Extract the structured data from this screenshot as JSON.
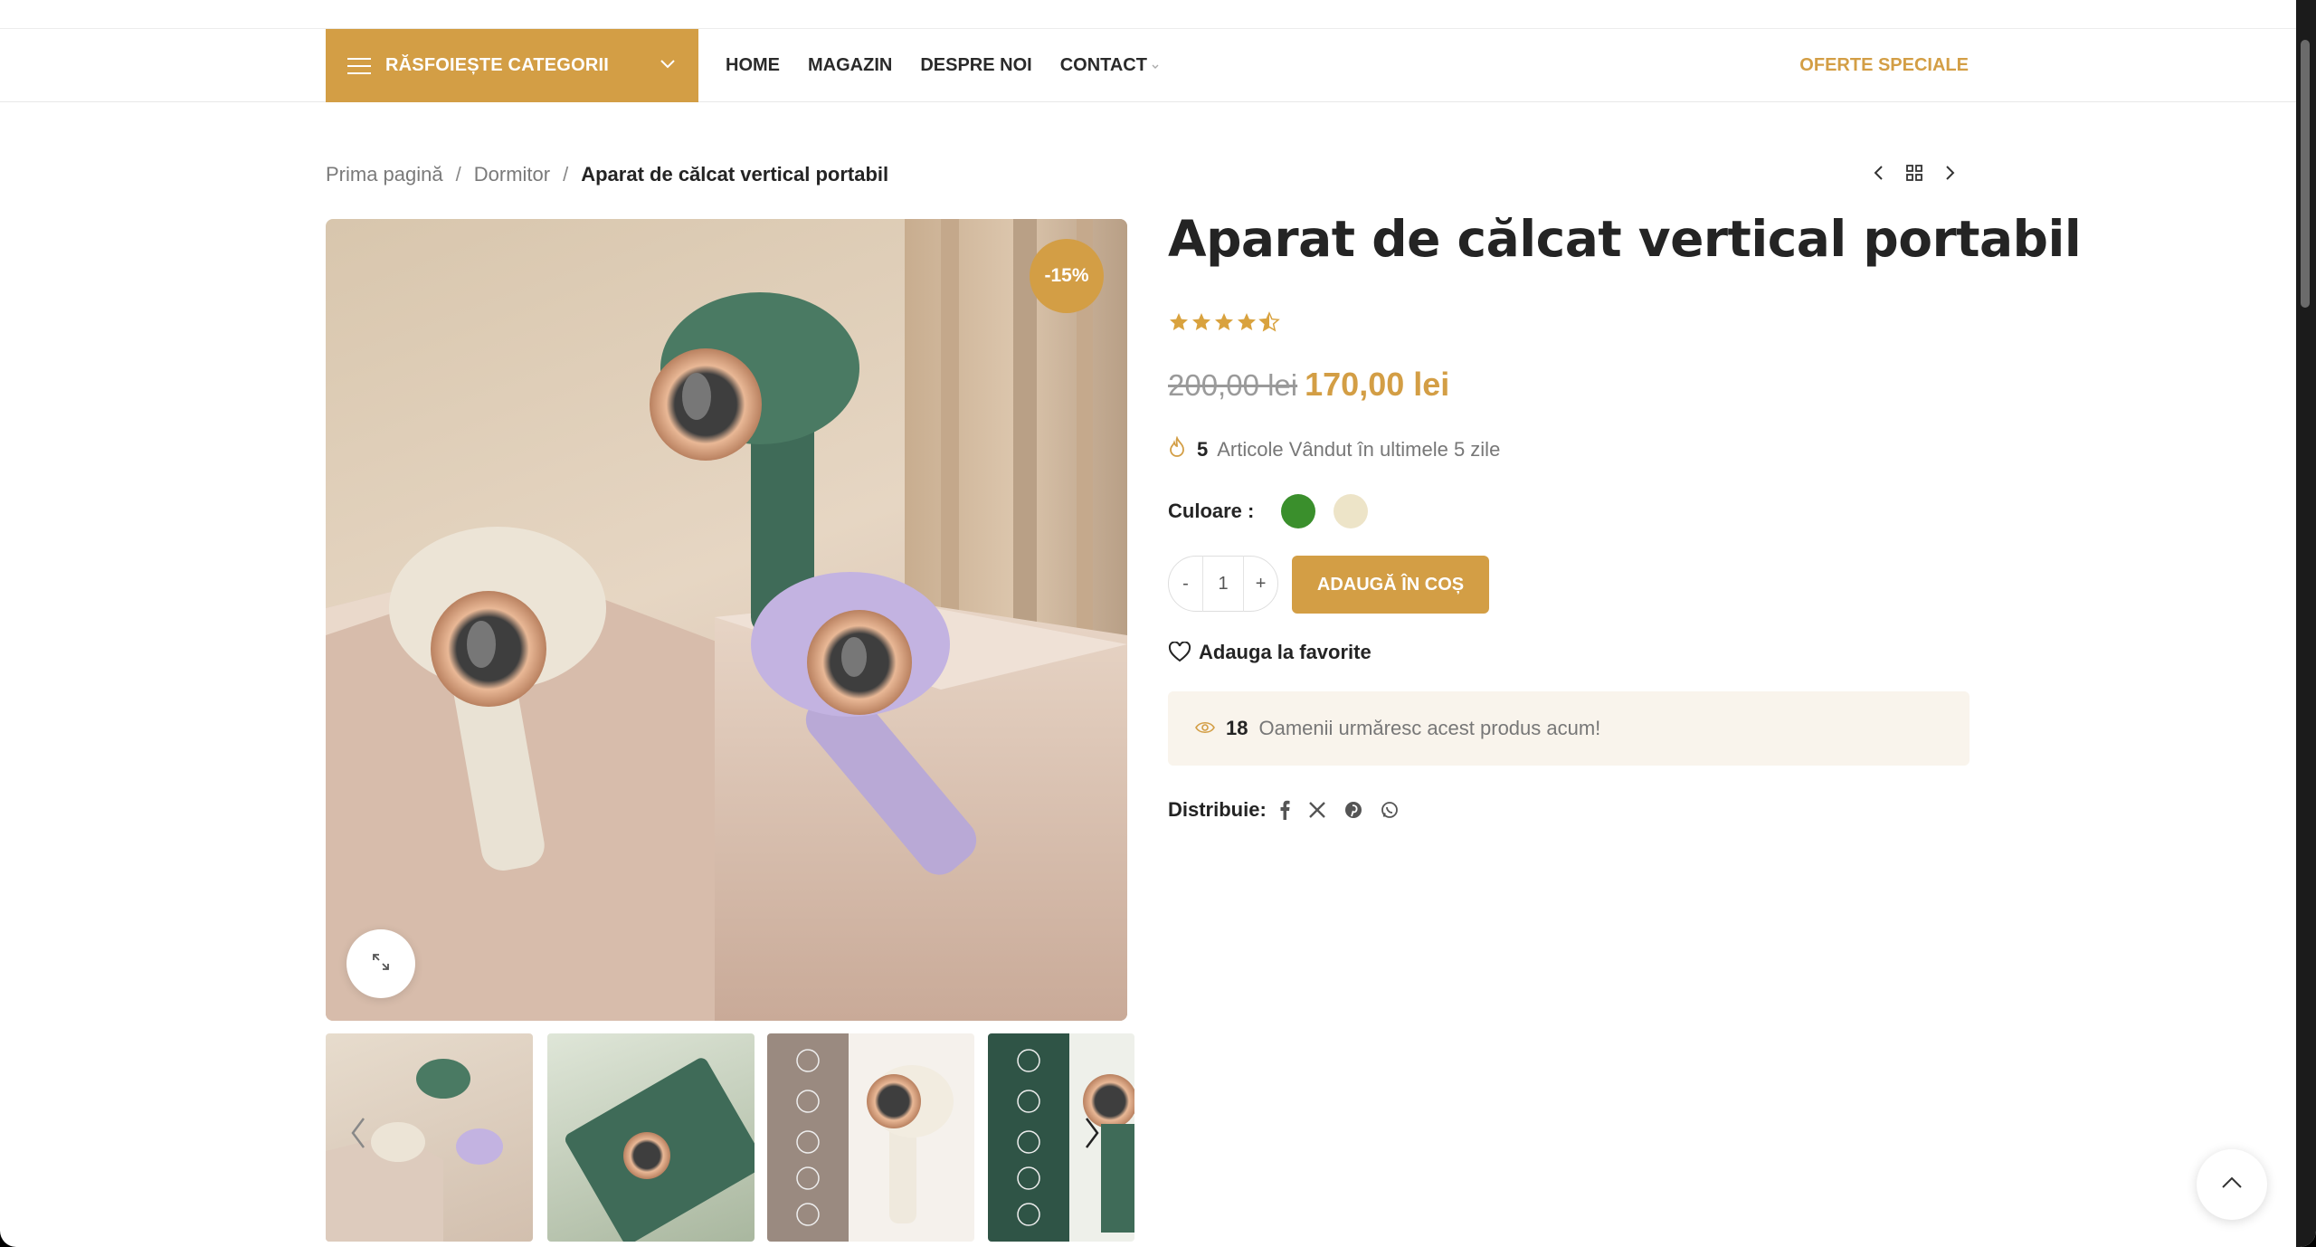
{
  "header": {
    "categories_label": "RĂSFOIEȘTE CATEGORII",
    "nav": [
      "HOME",
      "MAGAZIN",
      "DESPRE NOI",
      "CONTACT"
    ],
    "special_offers": "OFERTE SPECIALE"
  },
  "breadcrumb": {
    "home": "Prima pagină",
    "category": "Dormitor",
    "current": "Aparat de călcat vertical portabil",
    "separator": "/"
  },
  "product": {
    "title": "Aparat de călcat vertical portabil",
    "discount_badge": "-15%",
    "rating": 4.5,
    "rating_max": 5,
    "old_price": "200,00 lei",
    "new_price": "170,00 lei",
    "sold_count": "5",
    "sold_text": "Articole Vândut în ultimele 5 zile",
    "color_label": "Culoare :",
    "colors": [
      "#3a8f2c",
      "#ede4c8"
    ],
    "qty_minus": "-",
    "qty_value": "1",
    "qty_plus": "+",
    "add_to_cart": "ADAUGĂ ÎN COȘ",
    "wishlist": "Adauga la favorite",
    "watching_count": "18",
    "watching_text": "Oamenii urmăresc acest produs acum!",
    "share_label": "Distribuie:",
    "share_icons": [
      "facebook-icon",
      "x-icon",
      "pinterest-icon",
      "whatsapp-icon"
    ]
  },
  "colors": {
    "accent": "#d39e45",
    "text": "#242424",
    "muted": "#777777"
  }
}
